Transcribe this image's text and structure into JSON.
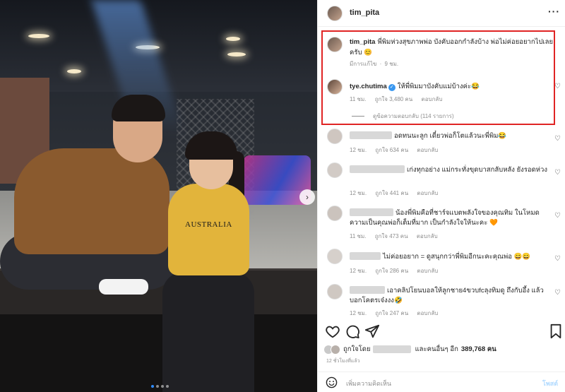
{
  "post": {
    "photo_shirt_text": "AUSTRALIA",
    "author": "tim_pita",
    "caption_text": "พี่พิมห่วงสุขภาพพ่อ บังคับออกกำลังบ้าง พ่อไม่ค่อยอยากไปเลยครับ 😊",
    "caption_meta": {
      "edited": "มีการแก้ไข",
      "separator": "·",
      "time": "9 ชม."
    }
  },
  "icons": {
    "more": "more-options-icon",
    "heart": "heart-icon",
    "comment": "comment-icon",
    "share": "share-icon",
    "save": "bookmark-icon",
    "emoji": "emoji-icon",
    "verified": "verified-badge-icon",
    "next": "chevron-right-icon"
  },
  "colors": {
    "highlight": "#e02424",
    "verified": "#3897f0",
    "post_button": "#b3dbff",
    "carousel_active": "#2f8cff"
  },
  "comments": [
    {
      "user": "tye.chutima",
      "verified": true,
      "text": "ให้พี่พิมมาบังคับแม่บ้างค่ะ😂",
      "time": "11 ชม.",
      "likes": "ถูกใจ 3,480 คน",
      "reply": "ตอบกลับ",
      "view_replies": "ดูข้อความตอบกลับ (114 รายการ)"
    },
    {
      "text": "อดทนนะลูก เดี๋ยวพ่อก็โตแล้วนะพี่พิม😂",
      "time": "12 ชม.",
      "likes": "ถูกใจ 634 คน",
      "reply": "ตอบกลับ"
    },
    {
      "text": "เก่งทุกอย่าง แม่กระทั่งขุดบาสกลับหลัง ยังรอดห่วง",
      "time": "12 ชม.",
      "likes": "ถูกใจ 441 คน",
      "reply": "ตอบกลับ"
    },
    {
      "text": "น้องพี่พิมคือที่ชาร์จแบตพลังใจของคุณทิม ในโหมดความเป็นคุณพ่อก็เต็มที่มาก เป็นกำลังใจให้นะคะ 🧡",
      "time": "11 ชม.",
      "likes": "ถูกใจ 473 คน",
      "reply": "ตอบกลับ"
    },
    {
      "text": "ไม่ค่อยอยาก = ดูสนุกกว่าพี่พิมอีกนะคะคุณพ่อ 😄😄",
      "time": "12 ชม.",
      "likes": "ถูกใจ 286 คน",
      "reply": "ตอบกลับ"
    },
    {
      "text": "เอาคลิปโยนบอลให้ลูกชาย4ขวบfcลุงทิมดู ถึงกับอึ้ง แล้วบอกโคตรเจ๋งงง🤣",
      "time": "12 ชม.",
      "likes": "ถูกใจ 247 คน",
      "reply": "ตอบกลับ"
    }
  ],
  "likes": {
    "prefix": "ถูกใจโดย",
    "mid": "และคนอื่นๆ อีก",
    "count": "389,768 คน"
  },
  "posted_ago": "12 ชั่วโมงที่แล้ว",
  "add_comment": {
    "placeholder": "เพิ่มความคิดเห็น",
    "post_label": "โพสต์"
  }
}
